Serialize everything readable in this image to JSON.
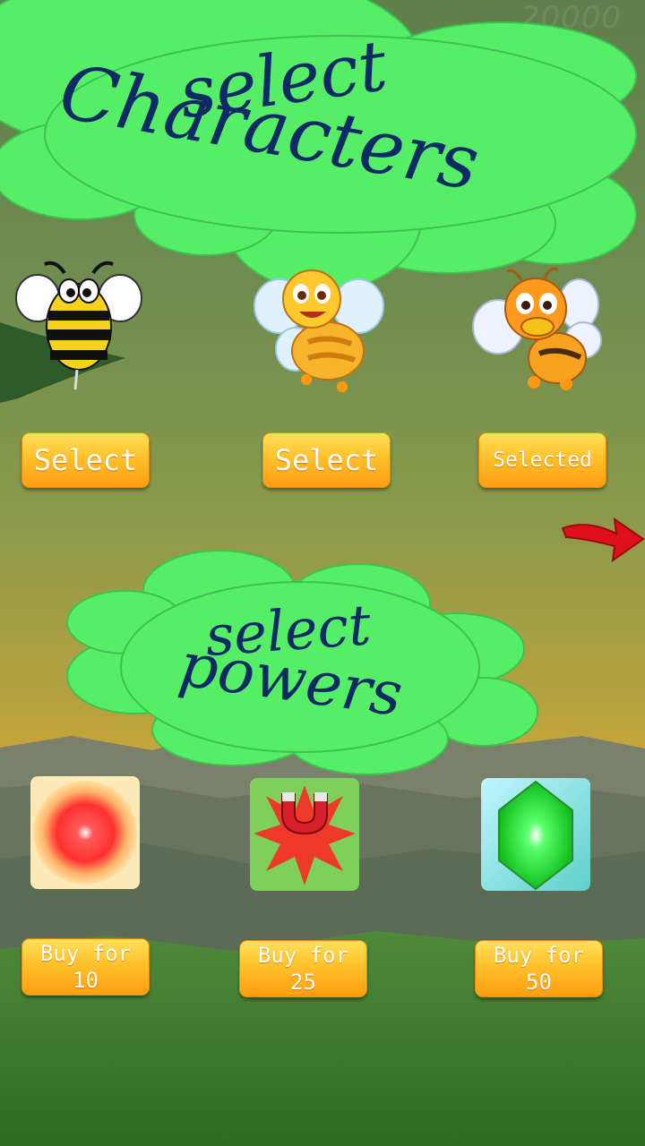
{
  "score": "20000",
  "titles": {
    "characters_line1": "select",
    "characters_line2": "Characters",
    "powers_line1": "select",
    "powers_line2": "powers"
  },
  "characters": [
    {
      "button_label": "Select",
      "state": "available"
    },
    {
      "button_label": "Select",
      "state": "available"
    },
    {
      "button_label": "Selected",
      "state": "selected"
    }
  ],
  "powers": [
    {
      "icon": "fireball-power-icon",
      "buy_label": "Buy for\n10"
    },
    {
      "icon": "magnet-power-icon",
      "buy_label": "Buy for\n25"
    },
    {
      "icon": "green-gem-power-icon",
      "buy_label": "Buy for\n50"
    }
  ],
  "colors": {
    "flower_green": "#55ee66",
    "title_text": "#102a66",
    "button_orange": "#ffb21f",
    "arrow_red": "#e0101a"
  }
}
